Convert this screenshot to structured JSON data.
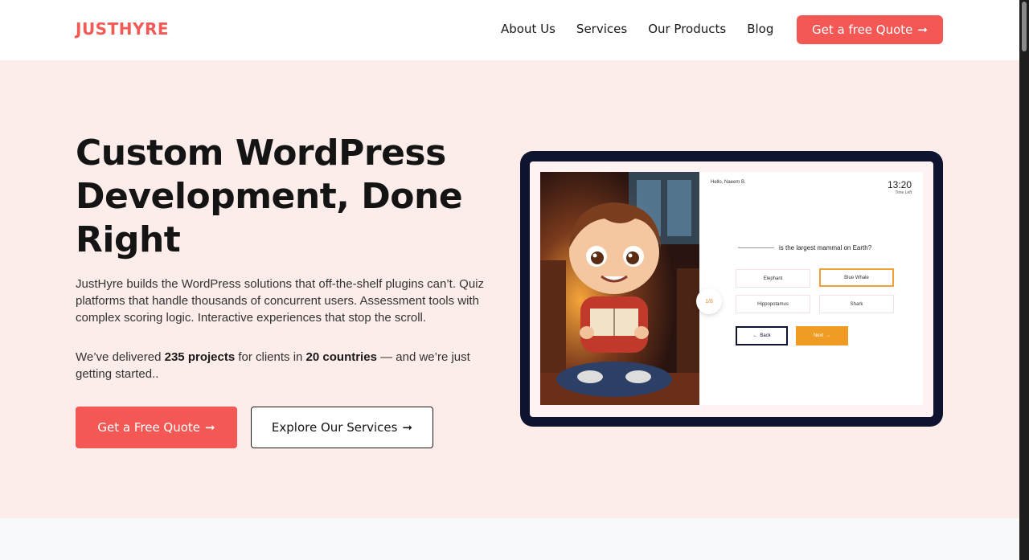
{
  "header": {
    "logo": "JUSTHYRE",
    "nav": [
      "About Us",
      "Services",
      "Our Products",
      "Blog"
    ],
    "cta_label": "Get a free Quote",
    "cta_arrow": "➞"
  },
  "hero": {
    "title": "Custom WordPress Development, Done Right",
    "description": "JustHyre builds the WordPress solutions that off-the-shelf plugins can’t. Quiz platforms that handle thousands of concurrent users. Assessment tools with complex scoring logic. Interactive experiences that stop the scroll.",
    "stats": {
      "prefix": "We’ve delivered ",
      "projects": "235 projects",
      "middle": " for clients in ",
      "countries": "20 countries",
      "suffix": " — and we’re just getting started.."
    },
    "primary_button": "Get a Free Quote",
    "secondary_button": "Explore Our Services",
    "arrow": "➞"
  },
  "quiz_mockup": {
    "greeting": "Hello, Naeem B.",
    "timer": "13:20",
    "timer_label": "Time Left",
    "question": "is the largest mammal on Earth?",
    "options": [
      "Elephant",
      "Blue Whale",
      "Hippopotamus",
      "Shark"
    ],
    "selected_option": "Blue Whale",
    "back_label": "Back",
    "next_label": "Next",
    "progress": "1/8"
  },
  "colors": {
    "brand": "#f25a55",
    "hero_bg": "#fcecea",
    "tablet_frame": "#0e1330",
    "quiz_accent": "#ef9b24"
  }
}
